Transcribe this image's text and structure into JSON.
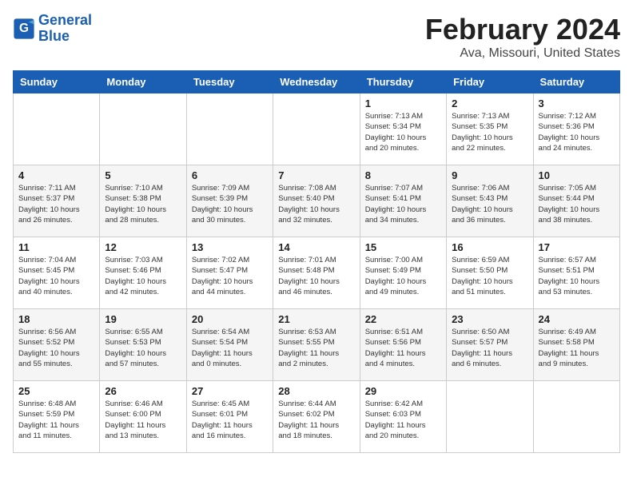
{
  "logo": {
    "line1": "General",
    "line2": "Blue"
  },
  "title": "February 2024",
  "subtitle": "Ava, Missouri, United States",
  "days_of_week": [
    "Sunday",
    "Monday",
    "Tuesday",
    "Wednesday",
    "Thursday",
    "Friday",
    "Saturday"
  ],
  "weeks": [
    [
      {
        "day": "",
        "info": ""
      },
      {
        "day": "",
        "info": ""
      },
      {
        "day": "",
        "info": ""
      },
      {
        "day": "",
        "info": ""
      },
      {
        "day": "1",
        "info": "Sunrise: 7:13 AM\nSunset: 5:34 PM\nDaylight: 10 hours\nand 20 minutes."
      },
      {
        "day": "2",
        "info": "Sunrise: 7:13 AM\nSunset: 5:35 PM\nDaylight: 10 hours\nand 22 minutes."
      },
      {
        "day": "3",
        "info": "Sunrise: 7:12 AM\nSunset: 5:36 PM\nDaylight: 10 hours\nand 24 minutes."
      }
    ],
    [
      {
        "day": "4",
        "info": "Sunrise: 7:11 AM\nSunset: 5:37 PM\nDaylight: 10 hours\nand 26 minutes."
      },
      {
        "day": "5",
        "info": "Sunrise: 7:10 AM\nSunset: 5:38 PM\nDaylight: 10 hours\nand 28 minutes."
      },
      {
        "day": "6",
        "info": "Sunrise: 7:09 AM\nSunset: 5:39 PM\nDaylight: 10 hours\nand 30 minutes."
      },
      {
        "day": "7",
        "info": "Sunrise: 7:08 AM\nSunset: 5:40 PM\nDaylight: 10 hours\nand 32 minutes."
      },
      {
        "day": "8",
        "info": "Sunrise: 7:07 AM\nSunset: 5:41 PM\nDaylight: 10 hours\nand 34 minutes."
      },
      {
        "day": "9",
        "info": "Sunrise: 7:06 AM\nSunset: 5:43 PM\nDaylight: 10 hours\nand 36 minutes."
      },
      {
        "day": "10",
        "info": "Sunrise: 7:05 AM\nSunset: 5:44 PM\nDaylight: 10 hours\nand 38 minutes."
      }
    ],
    [
      {
        "day": "11",
        "info": "Sunrise: 7:04 AM\nSunset: 5:45 PM\nDaylight: 10 hours\nand 40 minutes."
      },
      {
        "day": "12",
        "info": "Sunrise: 7:03 AM\nSunset: 5:46 PM\nDaylight: 10 hours\nand 42 minutes."
      },
      {
        "day": "13",
        "info": "Sunrise: 7:02 AM\nSunset: 5:47 PM\nDaylight: 10 hours\nand 44 minutes."
      },
      {
        "day": "14",
        "info": "Sunrise: 7:01 AM\nSunset: 5:48 PM\nDaylight: 10 hours\nand 46 minutes."
      },
      {
        "day": "15",
        "info": "Sunrise: 7:00 AM\nSunset: 5:49 PM\nDaylight: 10 hours\nand 49 minutes."
      },
      {
        "day": "16",
        "info": "Sunrise: 6:59 AM\nSunset: 5:50 PM\nDaylight: 10 hours\nand 51 minutes."
      },
      {
        "day": "17",
        "info": "Sunrise: 6:57 AM\nSunset: 5:51 PM\nDaylight: 10 hours\nand 53 minutes."
      }
    ],
    [
      {
        "day": "18",
        "info": "Sunrise: 6:56 AM\nSunset: 5:52 PM\nDaylight: 10 hours\nand 55 minutes."
      },
      {
        "day": "19",
        "info": "Sunrise: 6:55 AM\nSunset: 5:53 PM\nDaylight: 10 hours\nand 57 minutes."
      },
      {
        "day": "20",
        "info": "Sunrise: 6:54 AM\nSunset: 5:54 PM\nDaylight: 11 hours\nand 0 minutes."
      },
      {
        "day": "21",
        "info": "Sunrise: 6:53 AM\nSunset: 5:55 PM\nDaylight: 11 hours\nand 2 minutes."
      },
      {
        "day": "22",
        "info": "Sunrise: 6:51 AM\nSunset: 5:56 PM\nDaylight: 11 hours\nand 4 minutes."
      },
      {
        "day": "23",
        "info": "Sunrise: 6:50 AM\nSunset: 5:57 PM\nDaylight: 11 hours\nand 6 minutes."
      },
      {
        "day": "24",
        "info": "Sunrise: 6:49 AM\nSunset: 5:58 PM\nDaylight: 11 hours\nand 9 minutes."
      }
    ],
    [
      {
        "day": "25",
        "info": "Sunrise: 6:48 AM\nSunset: 5:59 PM\nDaylight: 11 hours\nand 11 minutes."
      },
      {
        "day": "26",
        "info": "Sunrise: 6:46 AM\nSunset: 6:00 PM\nDaylight: 11 hours\nand 13 minutes."
      },
      {
        "day": "27",
        "info": "Sunrise: 6:45 AM\nSunset: 6:01 PM\nDaylight: 11 hours\nand 16 minutes."
      },
      {
        "day": "28",
        "info": "Sunrise: 6:44 AM\nSunset: 6:02 PM\nDaylight: 11 hours\nand 18 minutes."
      },
      {
        "day": "29",
        "info": "Sunrise: 6:42 AM\nSunset: 6:03 PM\nDaylight: 11 hours\nand 20 minutes."
      },
      {
        "day": "",
        "info": ""
      },
      {
        "day": "",
        "info": ""
      }
    ]
  ]
}
